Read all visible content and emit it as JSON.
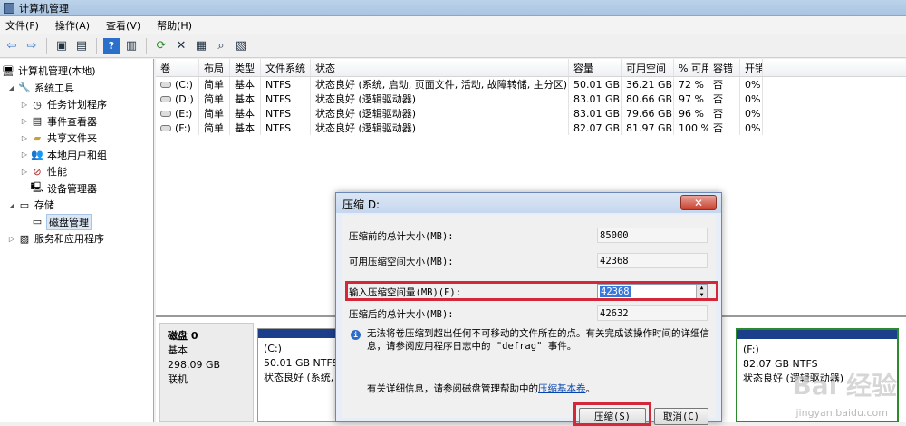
{
  "window": {
    "title": "计算机管理"
  },
  "menu": [
    "文件(F)",
    "操作(A)",
    "查看(V)",
    "帮助(H)"
  ],
  "tree": [
    {
      "label": "计算机管理(本地)",
      "level": 0,
      "exp": ""
    },
    {
      "label": "系统工具",
      "level": 1,
      "exp": "◢"
    },
    {
      "label": "任务计划程序",
      "level": 2,
      "exp": "▷"
    },
    {
      "label": "事件查看器",
      "level": 2,
      "exp": "▷"
    },
    {
      "label": "共享文件夹",
      "level": 2,
      "exp": "▷"
    },
    {
      "label": "本地用户和组",
      "level": 2,
      "exp": "▷"
    },
    {
      "label": "性能",
      "level": 2,
      "exp": "▷"
    },
    {
      "label": "设备管理器",
      "level": 2,
      "exp": ""
    },
    {
      "label": "存储",
      "level": 1,
      "exp": "◢"
    },
    {
      "label": "磁盘管理",
      "level": 2,
      "exp": "",
      "selected": true
    },
    {
      "label": "服务和应用程序",
      "level": 1,
      "exp": "▷"
    }
  ],
  "volume_table": {
    "headers": [
      "卷",
      "布局",
      "类型",
      "文件系统",
      "状态",
      "容量",
      "可用空间",
      "% 可用",
      "容错",
      "开销"
    ],
    "rows": [
      [
        "(C:)",
        "简单",
        "基本",
        "NTFS",
        "状态良好 (系统, 启动, 页面文件, 活动, 故障转储, 主分区)",
        "50.01 GB",
        "36.21 GB",
        "72 %",
        "否",
        "0%"
      ],
      [
        "(D:)",
        "简单",
        "基本",
        "NTFS",
        "状态良好 (逻辑驱动器)",
        "83.01 GB",
        "80.66 GB",
        "97 %",
        "否",
        "0%"
      ],
      [
        "(E:)",
        "简单",
        "基本",
        "NTFS",
        "状态良好 (逻辑驱动器)",
        "83.01 GB",
        "79.66 GB",
        "96 %",
        "否",
        "0%"
      ],
      [
        "(F:)",
        "简单",
        "基本",
        "NTFS",
        "状态良好 (逻辑驱动器)",
        "82.07 GB",
        "81.97 GB",
        "100 %",
        "否",
        "0%"
      ]
    ]
  },
  "disk": {
    "name": "磁盘 0",
    "type": "基本",
    "size": "298.09 GB",
    "status": "联机",
    "part_c": {
      "name": "(C:)",
      "size": "50.01 GB NTFS",
      "status": "状态良好 (系统,"
    },
    "part_f": {
      "name": "(F:)",
      "size": "82.07 GB NTFS",
      "status": "状态良好 (逻辑驱动器)"
    }
  },
  "dialog": {
    "title": "压缩 D:",
    "close": "✕",
    "total_before_label": "压缩前的总计大小(MB):",
    "total_before": "85000",
    "available_label": "可用压缩空间大小(MB):",
    "available": "42368",
    "input_label": "输入压缩空间量(MB)(E):",
    "input_value": "42368",
    "total_after_label": "压缩后的总计大小(MB):",
    "total_after": "42632",
    "info": "无法将卷压缩到超出任何不可移动的文件所在的点。有关完成该操作时间的详细信息，请参阅应用程序日志中的 \"defrag\" 事件。",
    "help_prefix": "有关详细信息，请参阅磁盘管理帮助中的",
    "help_link": "压缩基本卷",
    "help_suffix": "。",
    "ok": "压缩(S)",
    "cancel": "取消(C)"
  },
  "watermark": {
    "text": "Bai 经验",
    "url": "jingyan.baidu.com"
  }
}
